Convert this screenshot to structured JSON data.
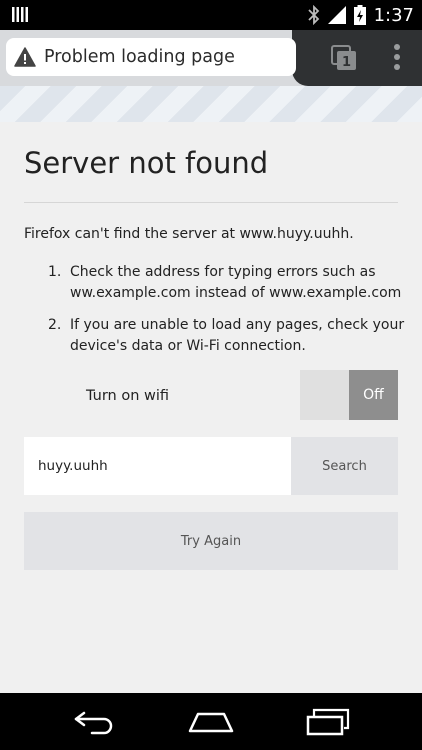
{
  "status_bar": {
    "time": "1:37",
    "icons": [
      "notification-icon",
      "bluetooth-icon",
      "signal-icon",
      "battery-icon"
    ]
  },
  "toolbar": {
    "page_title": "Problem loading page",
    "tab_count": "1",
    "icons": [
      "warning-icon",
      "tabs-icon",
      "menu-icon"
    ]
  },
  "error_page": {
    "title": "Server not found",
    "lead": "Firefox can't find the server at www.huyy.uuhh.",
    "steps": [
      {
        "num": "1.",
        "text": "Check the address for typing errors such as ww.example.com instead of www.example.com"
      },
      {
        "num": "2.",
        "text": "If you are unable to load any pages, check your device's data or Wi-Fi connection."
      }
    ],
    "wifi_label": "Turn on wifi",
    "wifi_toggle": "Off",
    "search_value": "huyy.uuhh",
    "search_label": "Search",
    "try_again_label": "Try Again"
  },
  "nav_bar": {
    "icons": [
      "back-icon",
      "home-icon",
      "recents-icon"
    ]
  },
  "colors": {
    "toolbar": "#d8dadd",
    "toolbar_dark": "#2f3133",
    "page_background": "#f0f0f0",
    "button": "#e2e3e6",
    "toggle_off": "#8e8e8e"
  }
}
